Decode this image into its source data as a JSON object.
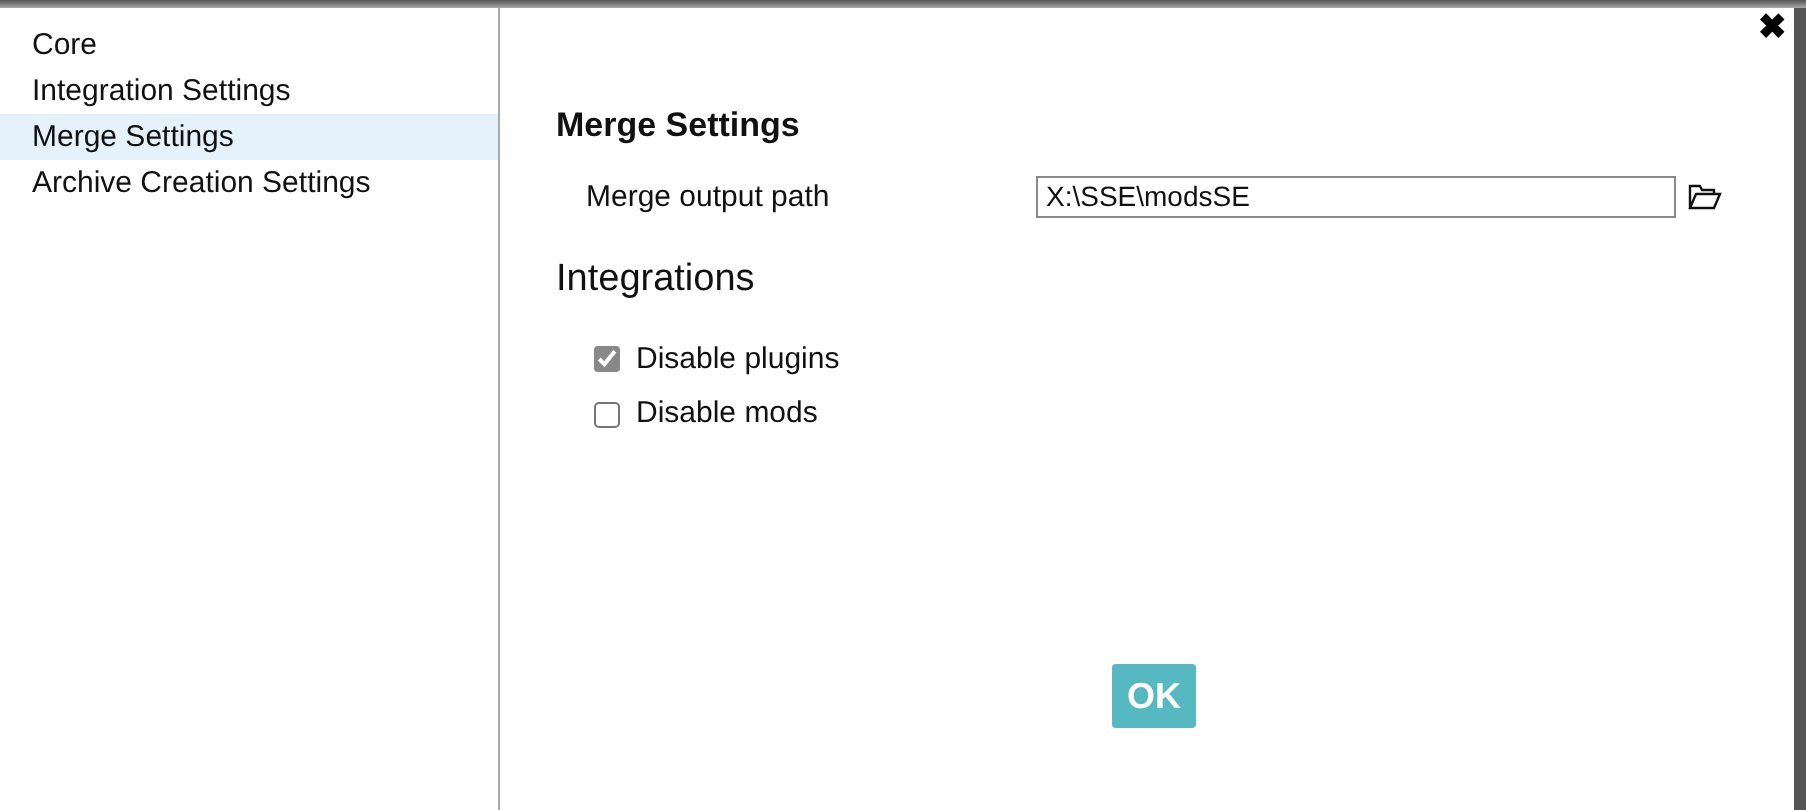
{
  "sidebar": {
    "items": [
      {
        "label": "Core",
        "selected": false
      },
      {
        "label": "Integration Settings",
        "selected": false
      },
      {
        "label": "Merge Settings",
        "selected": true
      },
      {
        "label": "Archive Creation Settings",
        "selected": false
      }
    ]
  },
  "close_button": {
    "label": "✖"
  },
  "content": {
    "title": "Merge Settings",
    "fields": [
      {
        "label": "Merge output path",
        "value": "X:\\SSE\\modsSE"
      }
    ],
    "section": "Integrations",
    "options": [
      {
        "label": "Disable plugins",
        "checked": true
      },
      {
        "label": "Disable mods",
        "checked": false
      }
    ]
  },
  "buttons": [
    "OK"
  ]
}
